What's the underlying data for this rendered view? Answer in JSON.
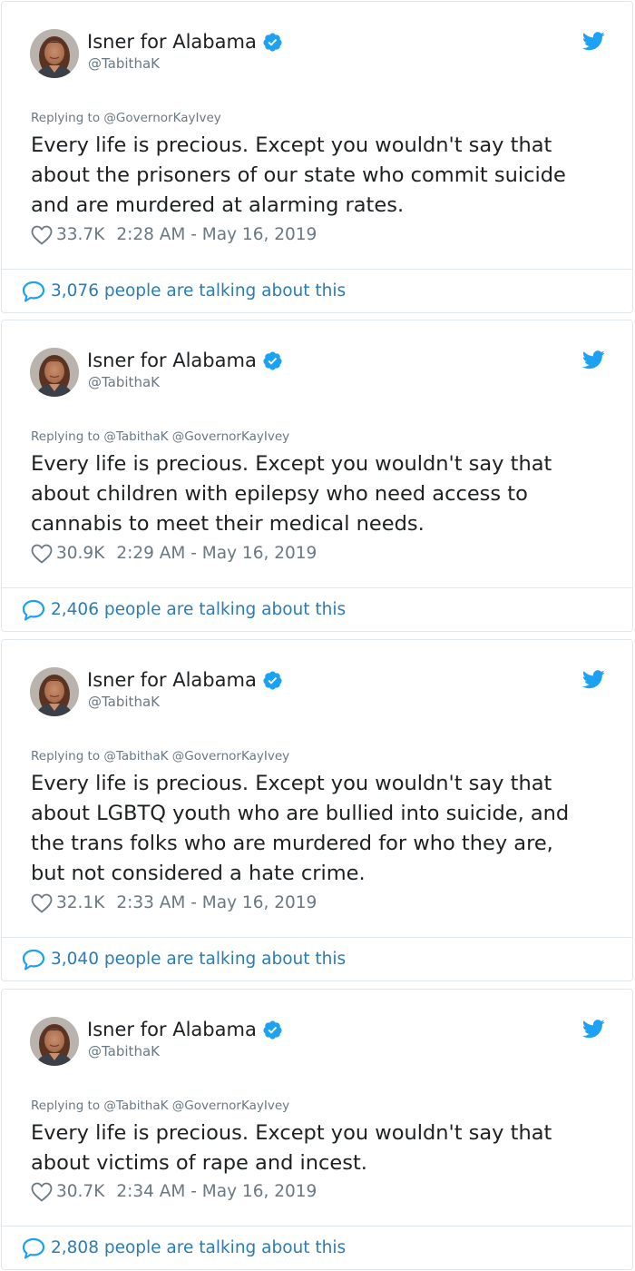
{
  "colors": {
    "twitter_blue": "#1da1f2",
    "link_blue": "#2b7bb9",
    "muted_text": "#697882",
    "primary_text": "#1c2022",
    "border": "#e1e8ed"
  },
  "icons": {
    "verified": "verified-badge-icon",
    "brand": "twitter-bird-icon",
    "like": "heart-icon",
    "conversation": "speech-bubble-icon"
  },
  "tweets": [
    {
      "author_name": "Isner for Alabama",
      "author_handle": "@TabithaK",
      "replying_to": "Replying to @GovernorKayIvey",
      "text": "Every life is precious. Except you wouldn't say that\nabout the prisoners of our state who commit suicide\nand are murdered at alarming rates.",
      "likes": "33.7K",
      "timestamp": "2:28 AM - May 16, 2019",
      "talking": "3,076 people are talking about this"
    },
    {
      "author_name": "Isner for Alabama",
      "author_handle": "@TabithaK",
      "replying_to": "Replying to @TabithaK @GovernorKayIvey",
      "text": "Every life is precious. Except you wouldn't say that\nabout children with epilepsy who need access to\ncannabis to meet their medical needs.",
      "likes": "30.9K",
      "timestamp": "2:29 AM - May 16, 2019",
      "talking": "2,406 people are talking about this"
    },
    {
      "author_name": "Isner for Alabama",
      "author_handle": "@TabithaK",
      "replying_to": "Replying to @TabithaK @GovernorKayIvey",
      "text": "Every life is precious. Except you wouldn't say that\nabout LGBTQ youth who are bullied into suicide, and\nthe trans folks who are murdered for who they are,\nbut not considered a hate crime.",
      "likes": "32.1K",
      "timestamp": "2:33 AM - May 16, 2019",
      "talking": "3,040 people are talking about this"
    },
    {
      "author_name": "Isner for Alabama",
      "author_handle": "@TabithaK",
      "replying_to": "Replying to @TabithaK @GovernorKayIvey",
      "text": "Every life is precious. Except you wouldn't say that\nabout victims of rape and incest.",
      "likes": "30.7K",
      "timestamp": "2:34 AM - May 16, 2019",
      "talking": "2,808 people are talking about this"
    }
  ]
}
